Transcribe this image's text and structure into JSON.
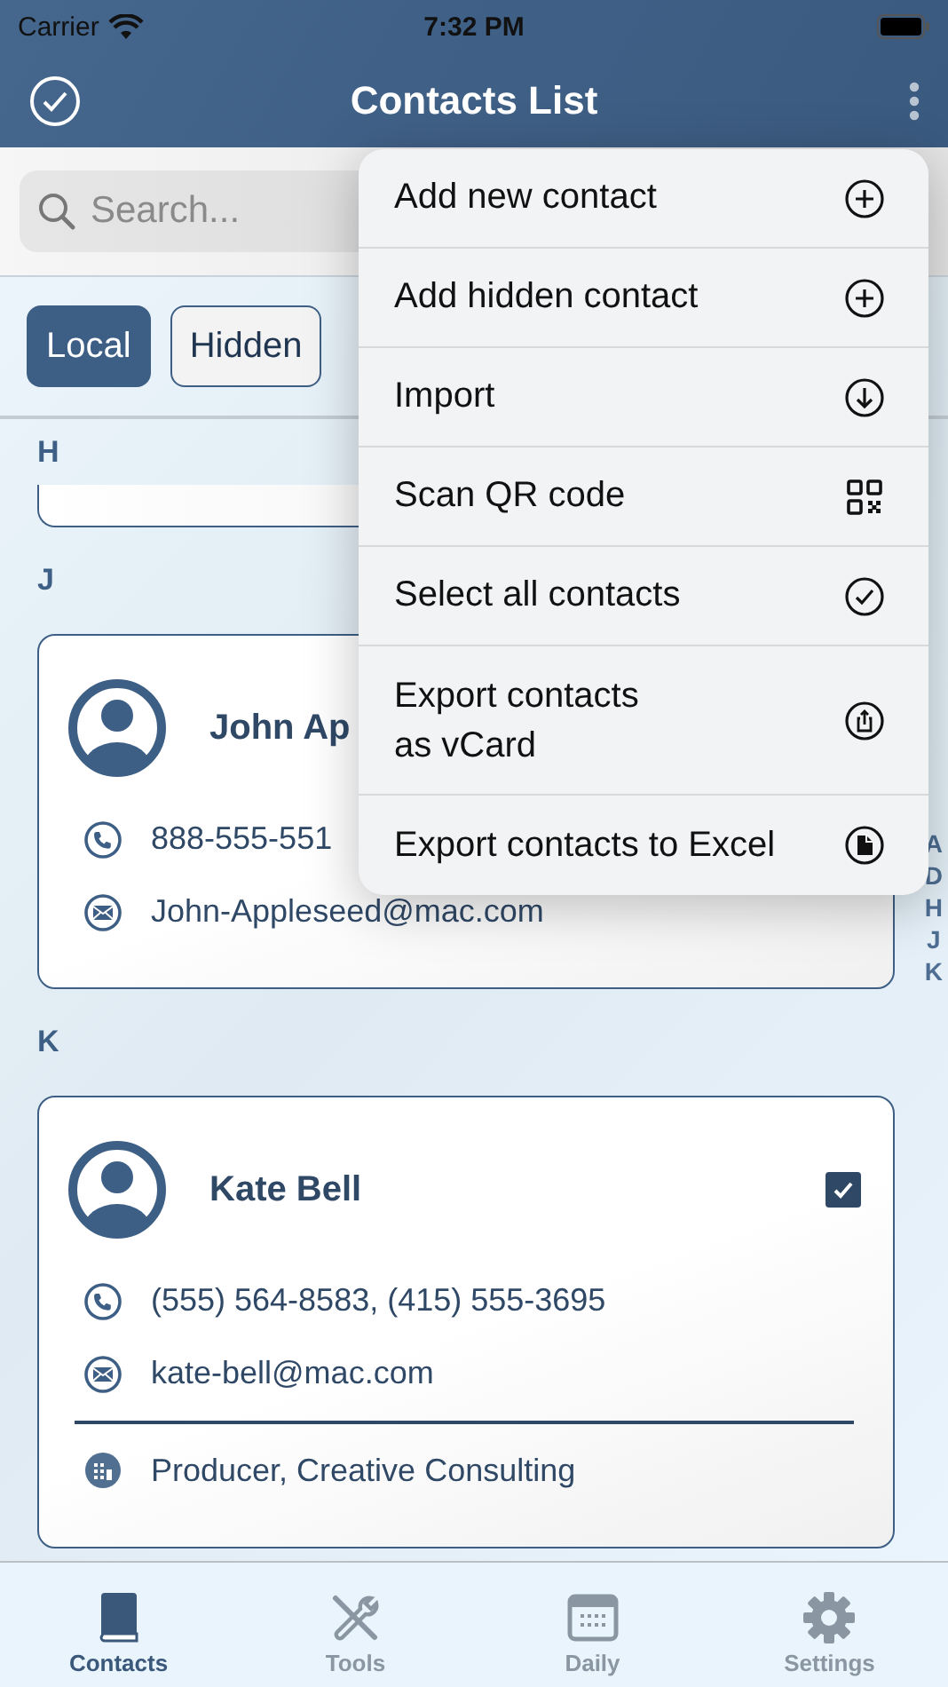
{
  "status_bar": {
    "carrier": "Carrier",
    "time": "7:32 PM"
  },
  "nav_bar": {
    "title": "Contacts List"
  },
  "search": {
    "placeholder": "Search..."
  },
  "filters": [
    {
      "label": "Local",
      "selected": true
    },
    {
      "label": "Hidden",
      "selected": false
    }
  ],
  "sections": [
    {
      "letter": "H",
      "contacts": [
        {
          "kind": "clipped"
        }
      ]
    },
    {
      "letter": "J",
      "contacts": [
        {
          "kind": "full",
          "name": "John Ap",
          "phone": "888-555-551",
          "email": "John-Appleseed@mac.com"
        }
      ]
    },
    {
      "letter": "K",
      "contacts": [
        {
          "kind": "full",
          "name": "Kate Bell",
          "checked": true,
          "phone": "(555) 564-8583, (415) 555-3695",
          "email": "kate-bell@mac.com",
          "company": "Producer, Creative Consulting"
        }
      ]
    }
  ],
  "index": [
    "A",
    "D",
    "H",
    "J",
    "K"
  ],
  "menu": [
    {
      "label": "Add new contact",
      "kind": "add"
    },
    {
      "label": "Add hidden contact",
      "kind": "add"
    },
    {
      "label": "Import",
      "kind": "import"
    },
    {
      "label": "Scan QR code",
      "kind": "qr"
    },
    {
      "label": "Select all contacts",
      "kind": "select"
    },
    {
      "label": "Export contacts\nas vCard",
      "kind": "share"
    },
    {
      "label": "Export contacts to Excel",
      "kind": "document"
    }
  ],
  "tab_bar": [
    {
      "label": "Contacts",
      "kind": "book",
      "selected": true
    },
    {
      "label": "Tools",
      "kind": "tools",
      "selected": false
    },
    {
      "label": "Daily",
      "kind": "calendar",
      "selected": false
    },
    {
      "label": "Settings",
      "kind": "gear",
      "selected": false
    }
  ]
}
